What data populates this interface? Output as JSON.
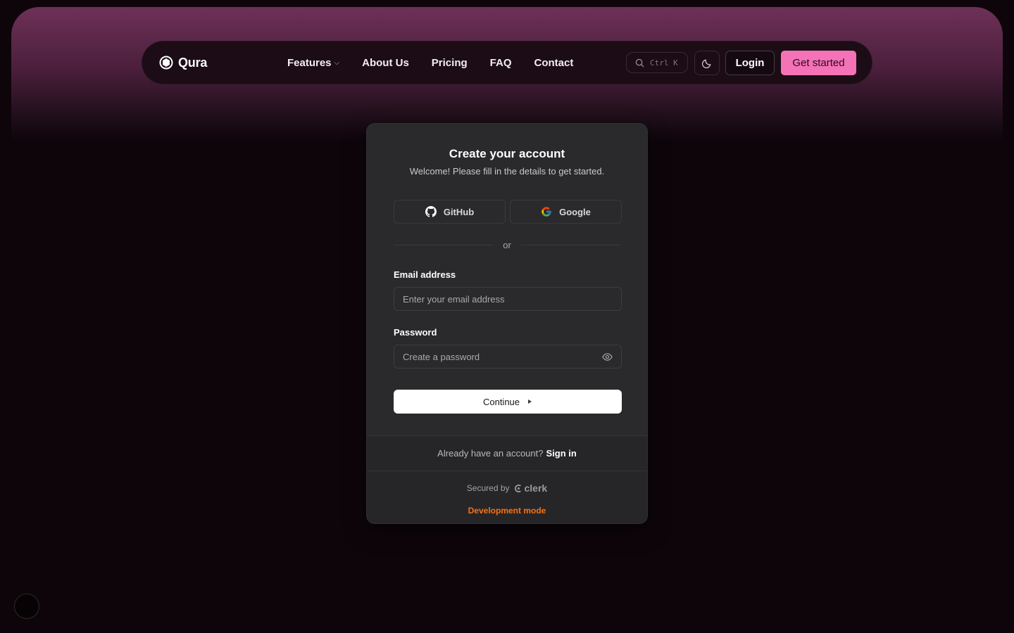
{
  "nav": {
    "brand": "Qura",
    "links": [
      "Features",
      "About Us",
      "Pricing",
      "FAQ",
      "Contact"
    ],
    "search_shortcut": "Ctrl K",
    "login_label": "Login",
    "cta_label": "Get started"
  },
  "auth": {
    "title": "Create your account",
    "subtitle": "Welcome! Please fill in the details to get started.",
    "github_label": "GitHub",
    "google_label": "Google",
    "divider_text": "or",
    "email_label": "Email address",
    "email_placeholder": "Enter your email address",
    "password_label": "Password",
    "password_placeholder": "Create a password",
    "continue_label": "Continue",
    "signin_prompt": "Already have an account?",
    "signin_link": "Sign in",
    "secured_by": "Secured by",
    "clerk_brand": "clerk",
    "dev_mode": "Development mode"
  },
  "colors": {
    "accent": "#f472b6",
    "background": "#0e050b",
    "card": "#2a2a2c",
    "dev_mode": "#f97316"
  }
}
